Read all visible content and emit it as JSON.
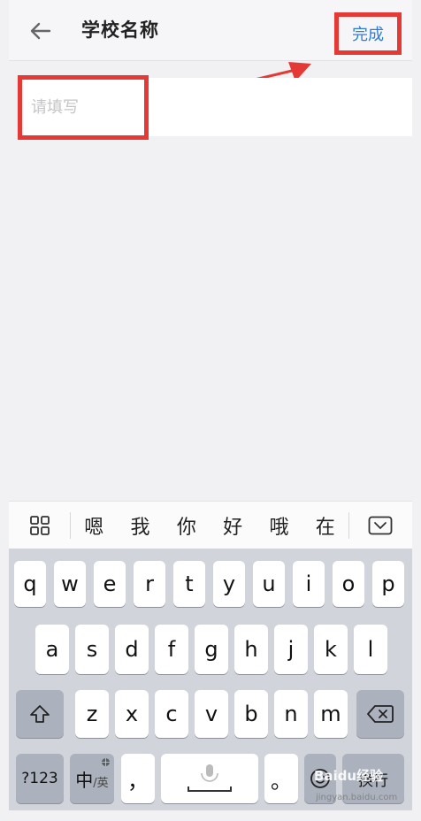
{
  "header": {
    "title": "学校名称",
    "done_label": "完成"
  },
  "form": {
    "school_name": {
      "value": "",
      "placeholder": "请填写"
    }
  },
  "annotation": {
    "highlight_color": "#e53935"
  },
  "ime": {
    "candidates": [
      "嗯",
      "我",
      "你",
      "好",
      "哦",
      "在"
    ]
  },
  "keyboard": {
    "row1": [
      "q",
      "w",
      "e",
      "r",
      "t",
      "y",
      "u",
      "i",
      "o",
      "p"
    ],
    "row2": [
      "a",
      "s",
      "d",
      "f",
      "g",
      "h",
      "j",
      "k",
      "l"
    ],
    "row3": [
      "z",
      "x",
      "c",
      "v",
      "b",
      "n",
      "m"
    ],
    "numbers_label": "?123",
    "lang_primary": "中",
    "lang_secondary": "/英",
    "comma": "，",
    "period": "。",
    "return_label": "换行"
  },
  "watermark": {
    "brand": "Baidu经验",
    "url": "jingyan.baidu.com"
  }
}
